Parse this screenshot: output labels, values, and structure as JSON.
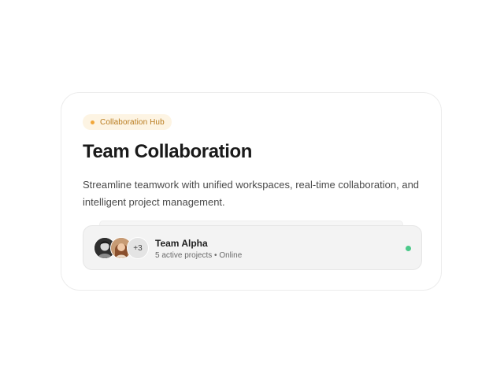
{
  "badge": {
    "label": "Collaboration Hub",
    "accent_color": "#f1a73a"
  },
  "card": {
    "title": "Team Collaboration",
    "description": "Streamline teamwork with unified workspaces, real-time collaboration, and intelligent project management."
  },
  "team": {
    "name": "Team Alpha",
    "projects_text": "5 active projects",
    "separator": "•",
    "status_text": "Online",
    "extra_members_label": "+3",
    "status_color": "#4cc98a"
  }
}
